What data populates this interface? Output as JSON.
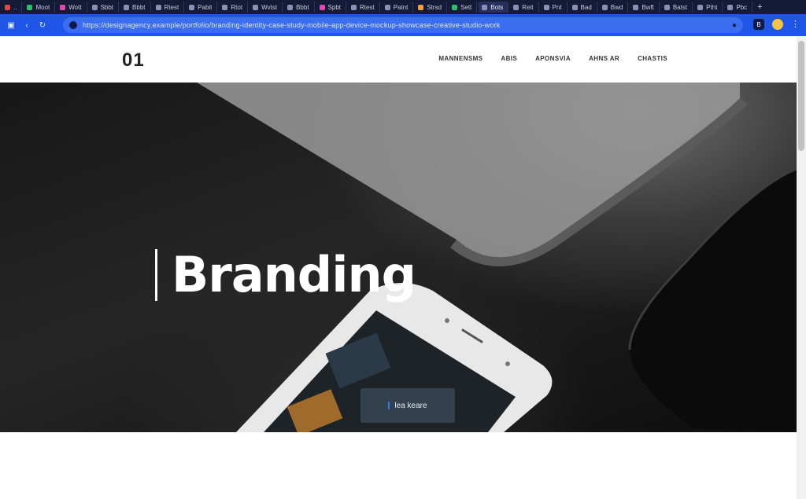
{
  "browser": {
    "tabs": [
      {
        "label": "..",
        "color": "red"
      },
      {
        "label": "Moot",
        "color": "green"
      },
      {
        "label": "Wott",
        "color": "pink"
      },
      {
        "label": "Sbbt",
        "color": ""
      },
      {
        "label": "Bbbt",
        "color": ""
      },
      {
        "label": "Rtest",
        "color": ""
      },
      {
        "label": "Pabit",
        "color": ""
      },
      {
        "label": "Rtot",
        "color": ""
      },
      {
        "label": "Wvtst",
        "color": ""
      },
      {
        "label": "Bbbt",
        "color": ""
      },
      {
        "label": "Spbt",
        "color": "pink"
      },
      {
        "label": "Rtest",
        "color": ""
      },
      {
        "label": "Patnt",
        "color": ""
      },
      {
        "label": "Strsd",
        "color": "orange"
      },
      {
        "label": "Sett",
        "color": "green"
      },
      {
        "label": "Bots",
        "color": ""
      },
      {
        "label": "Reit",
        "color": ""
      },
      {
        "label": "Pnt",
        "color": ""
      },
      {
        "label": "Bad",
        "color": ""
      },
      {
        "label": "Bwd",
        "color": ""
      },
      {
        "label": "Bwft",
        "color": ""
      },
      {
        "label": "Batst",
        "color": ""
      },
      {
        "label": "Ptht",
        "color": ""
      },
      {
        "label": "Pbc",
        "color": ""
      }
    ],
    "new_tab": "+",
    "url": "https://designagency.example/portfolio/branding-identity-case-study-mobile-app-device-mockup-showcase-creative-studio-work",
    "ext_label": "B"
  },
  "site": {
    "logo": "01",
    "nav": [
      "Mannensms",
      "Abis",
      "Aponsvia",
      "Ahns ar",
      "Chastis"
    ]
  },
  "hero": {
    "title": "Branding",
    "button_label": "lea keare"
  },
  "colors": {
    "tab_strip": "#151a36",
    "toolbar": "#1f56e8",
    "accent": "#2b7de9"
  }
}
